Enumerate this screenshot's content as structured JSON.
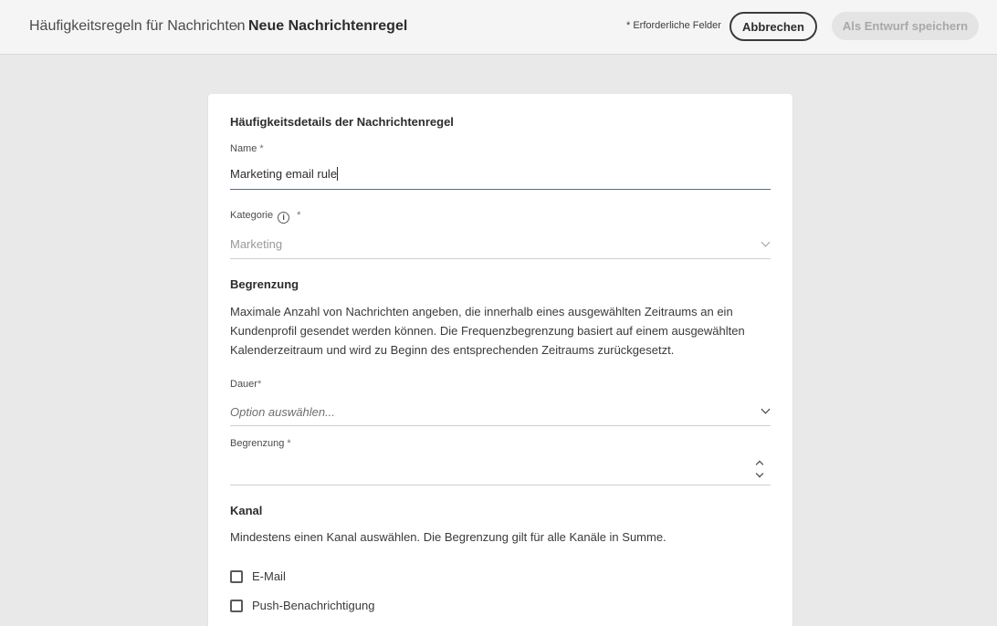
{
  "header": {
    "breadcrumb_parent": "Häufigkeitsregeln für Nachrichten",
    "breadcrumb_separator": "›",
    "breadcrumb_current": "Neue Nachrichtenregel",
    "required_note": "* Erforderliche Felder",
    "cancel_label": "Abbrechen",
    "save_draft_label": "Als Entwurf speichern"
  },
  "form": {
    "section_title": "Häufigkeitsdetails der Nachrichtenregel",
    "name": {
      "label": "Name",
      "required_mark": "*",
      "value": "Marketing email rule"
    },
    "category": {
      "label": "Kategorie",
      "info_icon": "i",
      "required_mark": "*",
      "value": "Marketing"
    },
    "capping": {
      "title": "Begrenzung",
      "description": "Maximale Anzahl von Nachrichten angeben, die innerhalb eines ausgewählten Zeitraums an ein Kundenprofil gesendet werden können. Die Frequenzbegrenzung basiert auf einem ausgewählten Kalenderzeitraum und wird zu Beginn des entsprechenden Zeitraums zurückgesetzt.",
      "duration": {
        "label": "Dauer",
        "required_mark": "*",
        "placeholder": "Option auswählen..."
      },
      "limit": {
        "label": "Begrenzung",
        "required_mark": "*",
        "value": ""
      }
    },
    "channel": {
      "title": "Kanal",
      "description": "Mindestens einen Kanal auswählen. Die Begrenzung gilt für alle Kanäle in Summe.",
      "options": [
        {
          "label": "E-Mail",
          "checked": false
        },
        {
          "label": "Push-Benachrichtigung",
          "checked": false
        }
      ]
    }
  },
  "colors": {
    "page_bg": "#e9e9e9",
    "card_bg": "#ffffff",
    "active_underline": "#3a6fd0",
    "disabled_button_bg": "#e4e4e4"
  }
}
